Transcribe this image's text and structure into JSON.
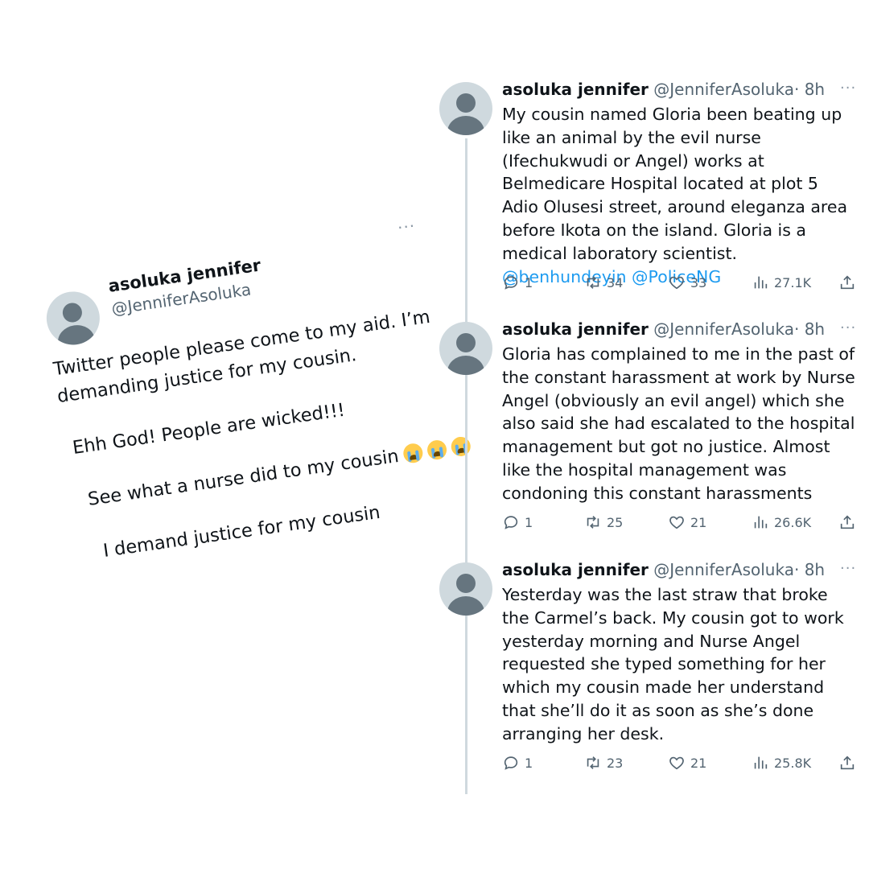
{
  "left_tweet": {
    "name": "asoluka jennifer",
    "handle": "@JenniferAsoluka",
    "more": "···",
    "lines": [
      "Twitter people please come to my aid. I’m",
      "demanding justice for my cousin.",
      "Ehh God! People are wicked!!!",
      "See what a nurse did to my cousin",
      "I demand justice for my cousin"
    ],
    "emoji": "loudly-crying-face"
  },
  "thread": [
    {
      "name": "asoluka jennifer",
      "handle": "@JenniferAsoluka",
      "time": "· 8h",
      "text": "My cousin named Gloria been beating up like an animal by the evil nurse (Ifechukwudi or Angel) works at Belmedicare Hospital located at plot 5 Adio Olusesi street, around eleganza area before Ikota on the island. Gloria is a medical laboratory scientist.",
      "mentions": "@benhundeyin @PoliceNG",
      "replies": "1",
      "retweets": "34",
      "likes": "33",
      "views": "27.1K"
    },
    {
      "name": "asoluka jennifer",
      "handle": "@JenniferAsoluka",
      "time": "· 8h",
      "text": "Gloria has complained to me in the past of the constant harassment at work by Nurse Angel (obviously an evil angel) which she also said she had escalated to the hospital management but got no justice. Almost like the hospital management was condoning this constant harassments",
      "replies": "1",
      "retweets": "25",
      "likes": "21",
      "views": "26.6K"
    },
    {
      "name": "asoluka jennifer",
      "handle": "@JenniferAsoluka",
      "time": "· 8h",
      "text": "Yesterday was the last straw that broke the Carmel’s back. My cousin got to work yesterday morning and Nurse Angel requested she typed something for her which my cousin made her understand that she’ll do it as soon as she’s done arranging her desk.",
      "replies": "1",
      "retweets": "23",
      "likes": "21",
      "views": "25.8K"
    }
  ],
  "colors": {
    "text": "#0f1419",
    "secondary": "#536471",
    "link": "#1d9bf0",
    "avatar_bg": "#cfd9de",
    "avatar_fg": "#66757f",
    "thread_line": "#cfd9de"
  },
  "icons": [
    "reply-icon",
    "retweet-icon",
    "like-icon",
    "views-icon",
    "share-icon",
    "more-icon"
  ]
}
